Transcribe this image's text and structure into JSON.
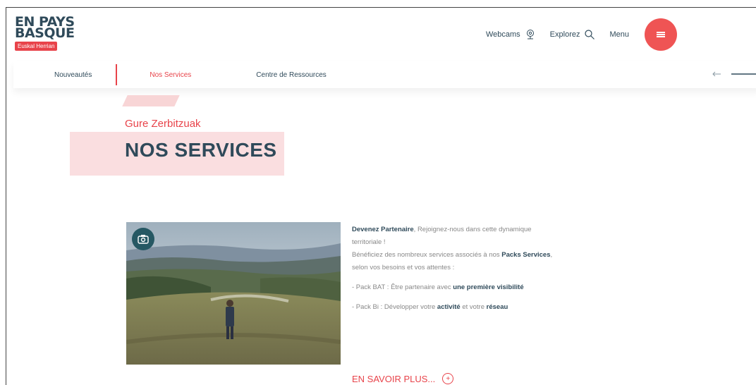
{
  "logo": {
    "line1": "EN PAYS",
    "line2": "BASQUE",
    "tag": "Euskal Herrian"
  },
  "top_nav": {
    "webcams": "Webcams",
    "explorez": "Explorez",
    "menu": "Menu"
  },
  "sub_nav": {
    "items": [
      {
        "label": "Nouveautés"
      },
      {
        "label": "Nos Services"
      },
      {
        "label": "Centre de Ressources"
      }
    ]
  },
  "hero": {
    "subtitle": "Gure Zerbitzuak",
    "title": "NOS SERVICES"
  },
  "card": {
    "intro_bold": "Devenez Partenaire",
    "intro_rest": ", Rejoignez-nous dans cette dynamique territoriale !",
    "line2_a": "Bénéficiez des nombreux services associés à nos",
    "line2_bold": "Packs Services",
    "line2_b": ", selon vos besoins et vos attentes :",
    "pack1_a": "- Pack BAT : Être partenaire avec",
    "pack1_bold": "une première visibilité",
    "pack2_a": "- Pack Bi : Développer votre",
    "pack2_bold1": "activité",
    "pack2_b": "et votre",
    "pack2_bold2": "réseau",
    "cta": "EN SAVOIR PLUS..."
  },
  "colors": {
    "accent": "#e8434a",
    "menu_button": "#ef5454",
    "navy": "#2f4a5a",
    "pink": "#f9d6d8",
    "camera_button": "#265863"
  },
  "icons": {
    "webcams": "webcam-icon",
    "explorez": "search-icon",
    "menu": "hamburger-icon",
    "photo": "camera-icon",
    "cta": "plus-circle-icon"
  }
}
